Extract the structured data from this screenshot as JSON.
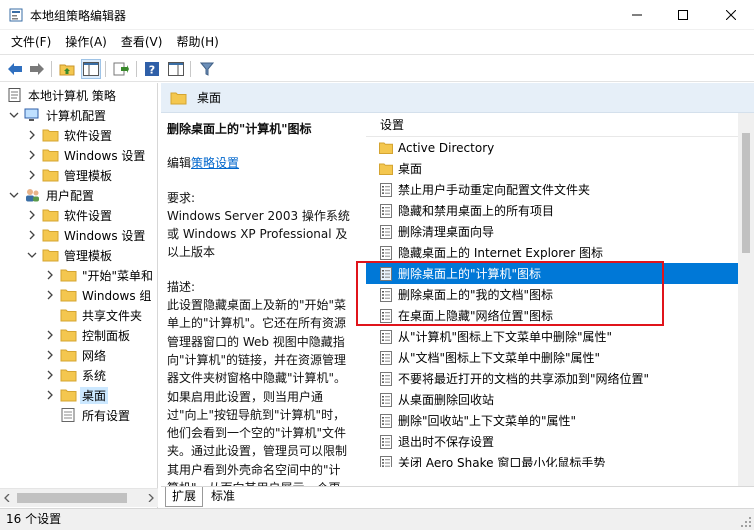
{
  "window": {
    "title": "本地组策略编辑器",
    "icon": "gpedit-app-icon"
  },
  "menu": [
    "文件(F)",
    "操作(A)",
    "查看(V)",
    "帮助(H)"
  ],
  "tree": {
    "root": "本地计算机 策略",
    "computer_config": "计算机配置",
    "cc_items": [
      "软件设置",
      "Windows 设置",
      "管理模板"
    ],
    "user_config": "用户配置",
    "uc_items": [
      "软件设置",
      "Windows 设置",
      "管理模板"
    ],
    "admin_items": [
      "\"开始\"菜单和",
      "Windows 组",
      "共享文件夹",
      "控制面板",
      "网络",
      "系统",
      "桌面",
      "所有设置"
    ]
  },
  "header": {
    "title": "桌面"
  },
  "description": {
    "title": "删除桌面上的\"计算机\"图标",
    "edit_prefix": "编辑",
    "edit_link": "策略设置",
    "requirements": "要求:\nWindows Server 2003 操作系统或 Windows XP Professional 及以上版本",
    "body": "描述:\n此设置隐藏桌面上及新的\"开始\"菜单上的\"计算机\"。它还在所有资源管理器窗口的 Web 视图中隐藏指向\"计算机\"的链接，并在资源管理器文件夹树窗格中隐藏\"计算机\"。如果启用此设置，则当用户通过\"向上\"按钮导航到\"计算机\"时，他们会看到一个空的\"计算机\"文件夹。通过此设置，管理员可以限制其用户看到外壳命名空间中的\"计算机\"，从而向其用户展示一个更为简洁的桌面环境"
  },
  "list": {
    "header": "设置",
    "rows": [
      {
        "label": "Active Directory",
        "type": "folder"
      },
      {
        "label": "桌面",
        "type": "folder"
      },
      {
        "label": "禁止用户手动重定向配置文件文件夹",
        "type": "setting"
      },
      {
        "label": "隐藏和禁用桌面上的所有项目",
        "type": "setting"
      },
      {
        "label": "删除清理桌面向导",
        "type": "setting"
      },
      {
        "label": "隐藏桌面上的 Internet Explorer 图标",
        "type": "setting"
      },
      {
        "label": "删除桌面上的\"计算机\"图标",
        "type": "setting",
        "selected": true
      },
      {
        "label": "删除桌面上的\"我的文档\"图标",
        "type": "setting"
      },
      {
        "label": "在桌面上隐藏\"网络位置\"图标",
        "type": "setting"
      },
      {
        "label": "从\"计算机\"图标上下文菜单中删除\"属性\"",
        "type": "setting"
      },
      {
        "label": "从\"文档\"图标上下文菜单中删除\"属性\"",
        "type": "setting"
      },
      {
        "label": "不要将最近打开的文档的共享添加到\"网络位置\"",
        "type": "setting"
      },
      {
        "label": "从桌面删除回收站",
        "type": "setting"
      },
      {
        "label": "删除\"回收站\"上下文菜单的\"属性\"",
        "type": "setting"
      },
      {
        "label": "退出时不保存设置",
        "type": "setting"
      },
      {
        "label": "关闭 Aero Shake 窗口最小化鼠标手势",
        "type": "setting"
      }
    ]
  },
  "tabs": [
    "扩展",
    "标准"
  ],
  "status": "16 个设置",
  "colors": {
    "selection": "#0078d7",
    "header_bg": "#e6eff8",
    "highlight_border": "#e0141b",
    "folder": "#f4c74f"
  }
}
